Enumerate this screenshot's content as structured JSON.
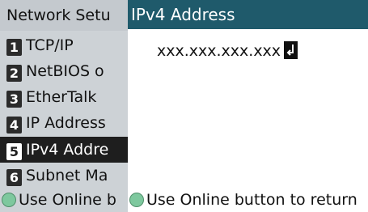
{
  "menu": {
    "title": "Network Setu",
    "items": [
      {
        "number": "1",
        "label": "TCP/IP"
      },
      {
        "number": "2",
        "label": "NetBIOS o"
      },
      {
        "number": "3",
        "label": "EtherTalk"
      },
      {
        "number": "4",
        "label": "IP Address"
      },
      {
        "number": "5",
        "label": "IPv4 Addre"
      },
      {
        "number": "6",
        "label": "Subnet Ma"
      }
    ],
    "selected_index": 4,
    "footer": "Use Online b"
  },
  "detail": {
    "title": "IPv4 Address",
    "address_value": "xxx.xxx.xxx.xxx",
    "footer": "Use Online button to return"
  },
  "icons": {
    "online_button": "circle-button-icon",
    "enter": "enter-key-icon"
  },
  "colors": {
    "header_bg": "#1f5a6b",
    "menu_bg": "#cdd2d6",
    "selected_bg": "#1e1e1e",
    "online_button": "#7ec89e"
  }
}
